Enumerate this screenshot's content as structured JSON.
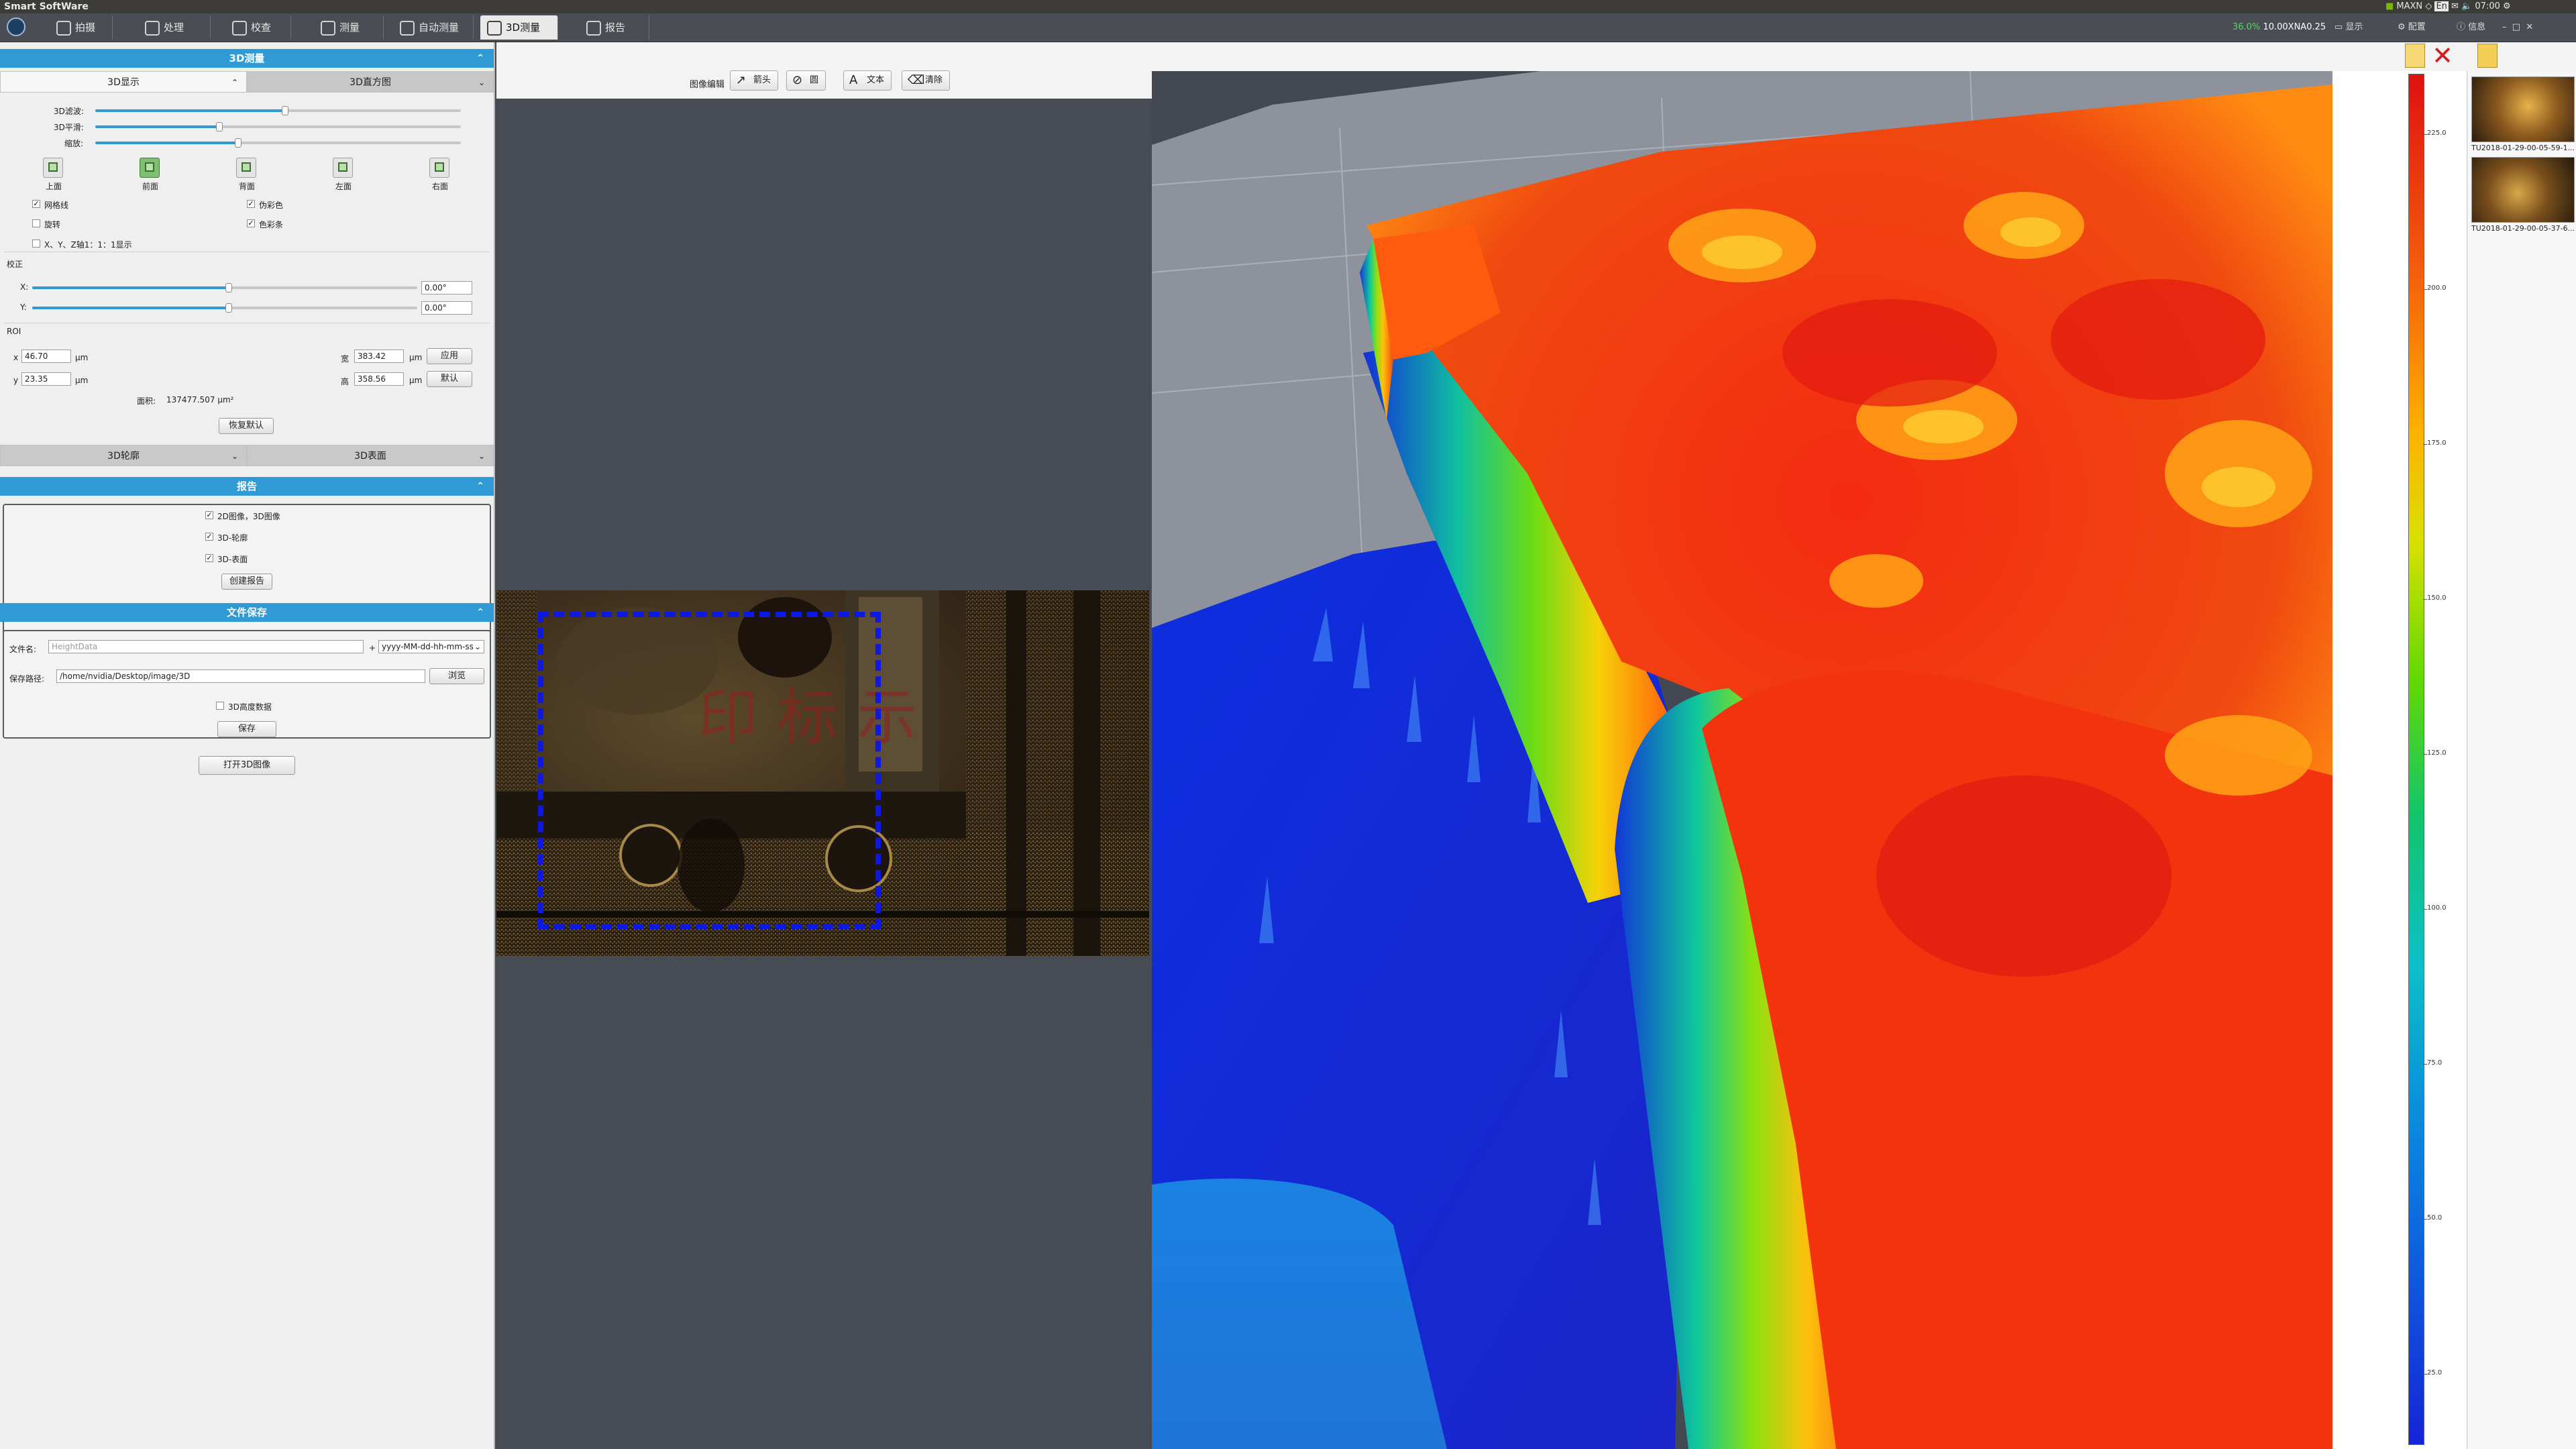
{
  "app": {
    "title": "Smart SoftWare"
  },
  "menu": {
    "tabs": [
      {
        "label": "拍摄"
      },
      {
        "label": "处理"
      },
      {
        "label": "校查"
      },
      {
        "label": "测量"
      },
      {
        "label": "自动测量"
      },
      {
        "label": "3D测量"
      },
      {
        "label": "报告"
      }
    ],
    "active_tab": "3D测量"
  },
  "tray": {
    "percent": "36.0%",
    "status": "10.00XNA0.25",
    "show": "显示",
    "config": "配置",
    "info": "信息",
    "maxn": "MAXN",
    "en": "En",
    "time": "07:00"
  },
  "left": {
    "measure3d": {
      "header": "3D测量",
      "tab_display": "3D显示",
      "tab_histogram": "3D直方图",
      "slider_filter_label": "3D滤波:",
      "slider_filter_value": 0.52,
      "slider_smooth_label": "3D平滑:",
      "slider_smooth_value": 0.34,
      "slider_zoom_label": "缩放:",
      "slider_zoom_value": 0.39,
      "views": [
        {
          "label": "上面"
        },
        {
          "label": "前面"
        },
        {
          "label": "背面"
        },
        {
          "label": "左面"
        },
        {
          "label": "右面"
        }
      ],
      "active_view": "前面",
      "opt_grid": "网格线",
      "opt_pseudo": "伪彩色",
      "opt_rotate": "旋转",
      "opt_colorbar": "色彩条",
      "opt_ratio": "X、Y、Z轴1：1：1显示",
      "correction_label": "校正",
      "corr_x_label": "X:",
      "corr_x_value": "0.00°",
      "corr_x_pos": 0.51,
      "corr_y_label": "Y:",
      "corr_y_value": "0.00°",
      "corr_y_pos": 0.51,
      "roi_label": "ROI",
      "roi_x_label": "x",
      "roi_x": "46.70",
      "roi_y_label": "y",
      "roi_y": "23.35",
      "roi_unit": "μm",
      "roi_w_label": "宽",
      "roi_w": "383.42",
      "roi_h_label": "高",
      "roi_h": "358.56",
      "apply_btn": "应用",
      "default_btn": "默认",
      "area_label": "面积:",
      "area_value": "137477.507 μm²",
      "restore_btn": "恢复默认",
      "tab_profile": "3D轮廓",
      "tab_surface": "3D表面"
    },
    "report": {
      "header": "报告",
      "opt1": "2D图像，3D图像",
      "opt2": "3D-轮廓",
      "opt3": "3D-表面",
      "create_btn": "创建报告"
    },
    "save": {
      "header": "文件保存",
      "filename_label": "文件名:",
      "filename_placeholder": "HeightData",
      "plus": "+",
      "format_value": "yyyy-MM-dd-hh-mm-ss",
      "path_label": "保存路径:",
      "path_value": "/home/nvidia/Desktop/image/3D",
      "browse_btn": "浏览",
      "height_data_opt": "3D高度数据",
      "save_btn": "保存"
    },
    "open3d_btn": "打开3D图像"
  },
  "toolbar": {
    "label": "图像编辑",
    "arrow": "箭头",
    "circle": "圆",
    "text": "文本",
    "clear": "清除"
  },
  "colorbar": {
    "ticks": [
      "225.0",
      "200.0",
      "175.0",
      "150.0",
      "125.0",
      "100.0",
      "75.0",
      "50.0",
      "25.0"
    ]
  },
  "thumbnails": [
    {
      "label": "TU2018-01-29-00-05-59-1..."
    },
    {
      "label": "TU2018-01-29-00-05-37-6..."
    }
  ],
  "colors": {
    "accent": "#2f9ad3",
    "roi": "#0d18e0",
    "canvas": "#464b54"
  }
}
